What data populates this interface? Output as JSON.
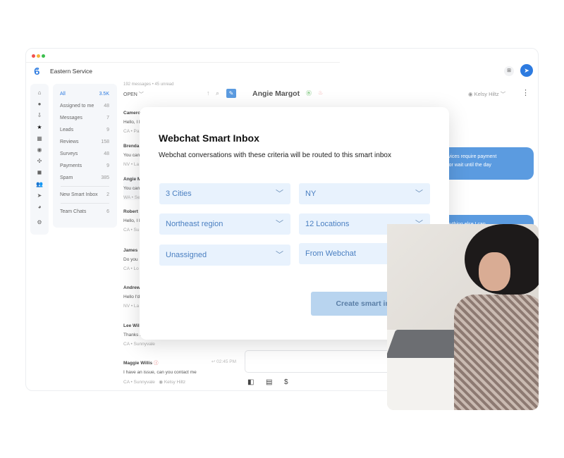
{
  "app": {
    "title": "Eastern Service"
  },
  "rail_icons": [
    "home-icon",
    "chat-icon",
    "inbox-icon",
    "star-icon",
    "calendar-icon",
    "settings-circle-icon",
    "network-icon",
    "messages-icon",
    "users-icon",
    "send-icon",
    "chart-icon",
    "gear-icon"
  ],
  "folders": [
    {
      "label": "All",
      "count": "3.5K"
    },
    {
      "label": "Assigned to me",
      "count": "48"
    },
    {
      "label": "Messages",
      "count": "7"
    },
    {
      "label": "Leads",
      "count": "9"
    },
    {
      "label": "Reviews",
      "count": "158"
    },
    {
      "label": "Surveys",
      "count": "48"
    },
    {
      "label": "Payments",
      "count": "9"
    },
    {
      "label": "Spam",
      "count": "385"
    }
  ],
  "smart_inbox": {
    "label": "New Smart Inbox",
    "count": "2"
  },
  "team_chats": {
    "label": "Team Chats",
    "count": "6"
  },
  "list": {
    "summary": "192 messages • 45 unread",
    "filter": "OPEN",
    "conversations": [
      {
        "name": "Camero",
        "msg": "Hello, I l",
        "loc": "CA • Pa"
      },
      {
        "name": "Brenda",
        "msg": "You can",
        "loc": "NV • La"
      },
      {
        "name": "Angie M",
        "msg": "You can",
        "loc": "WA • Se"
      },
      {
        "name": "Robert",
        "msg": "Hello, I l",
        "loc": "CA • Su"
      },
      {
        "name": "James",
        "msg": "Do you",
        "loc": "CA • Lo"
      },
      {
        "name": "Andrew",
        "msg": "Hello I'd",
        "loc": "NV • La"
      },
      {
        "name": "Lee Wil",
        "msg": "Thanks for the quick response!",
        "loc": "CA • Sunnyvale"
      },
      {
        "name": "Maggie Willis",
        "msg": "I have an issue, can you contact me",
        "loc": "CA • Sunnyvale",
        "time": "02:45 PM",
        "agent": "Kelsy Hiltz"
      }
    ]
  },
  "chat": {
    "contact": "Angie Margot",
    "agent": "Kelsy Hiltz",
    "bubbles": [
      "ening services require payment",
      "pay now, or wait until the day",
      "s there anything else I can"
    ]
  },
  "modal": {
    "title": "Webchat Smart Inbox",
    "subtitle": "Webchat conversations with these criteria will be routed to this smart inbox",
    "fields": [
      "3 Cities",
      "NY",
      "Northeast region",
      "12 Locations",
      "Unassigned",
      "From Webchat"
    ],
    "button": "Create smart inbox"
  },
  "colors": {
    "accent": "#2d7be0",
    "field_bg": "#e8f2fd",
    "button_bg": "#b8d4ef"
  }
}
